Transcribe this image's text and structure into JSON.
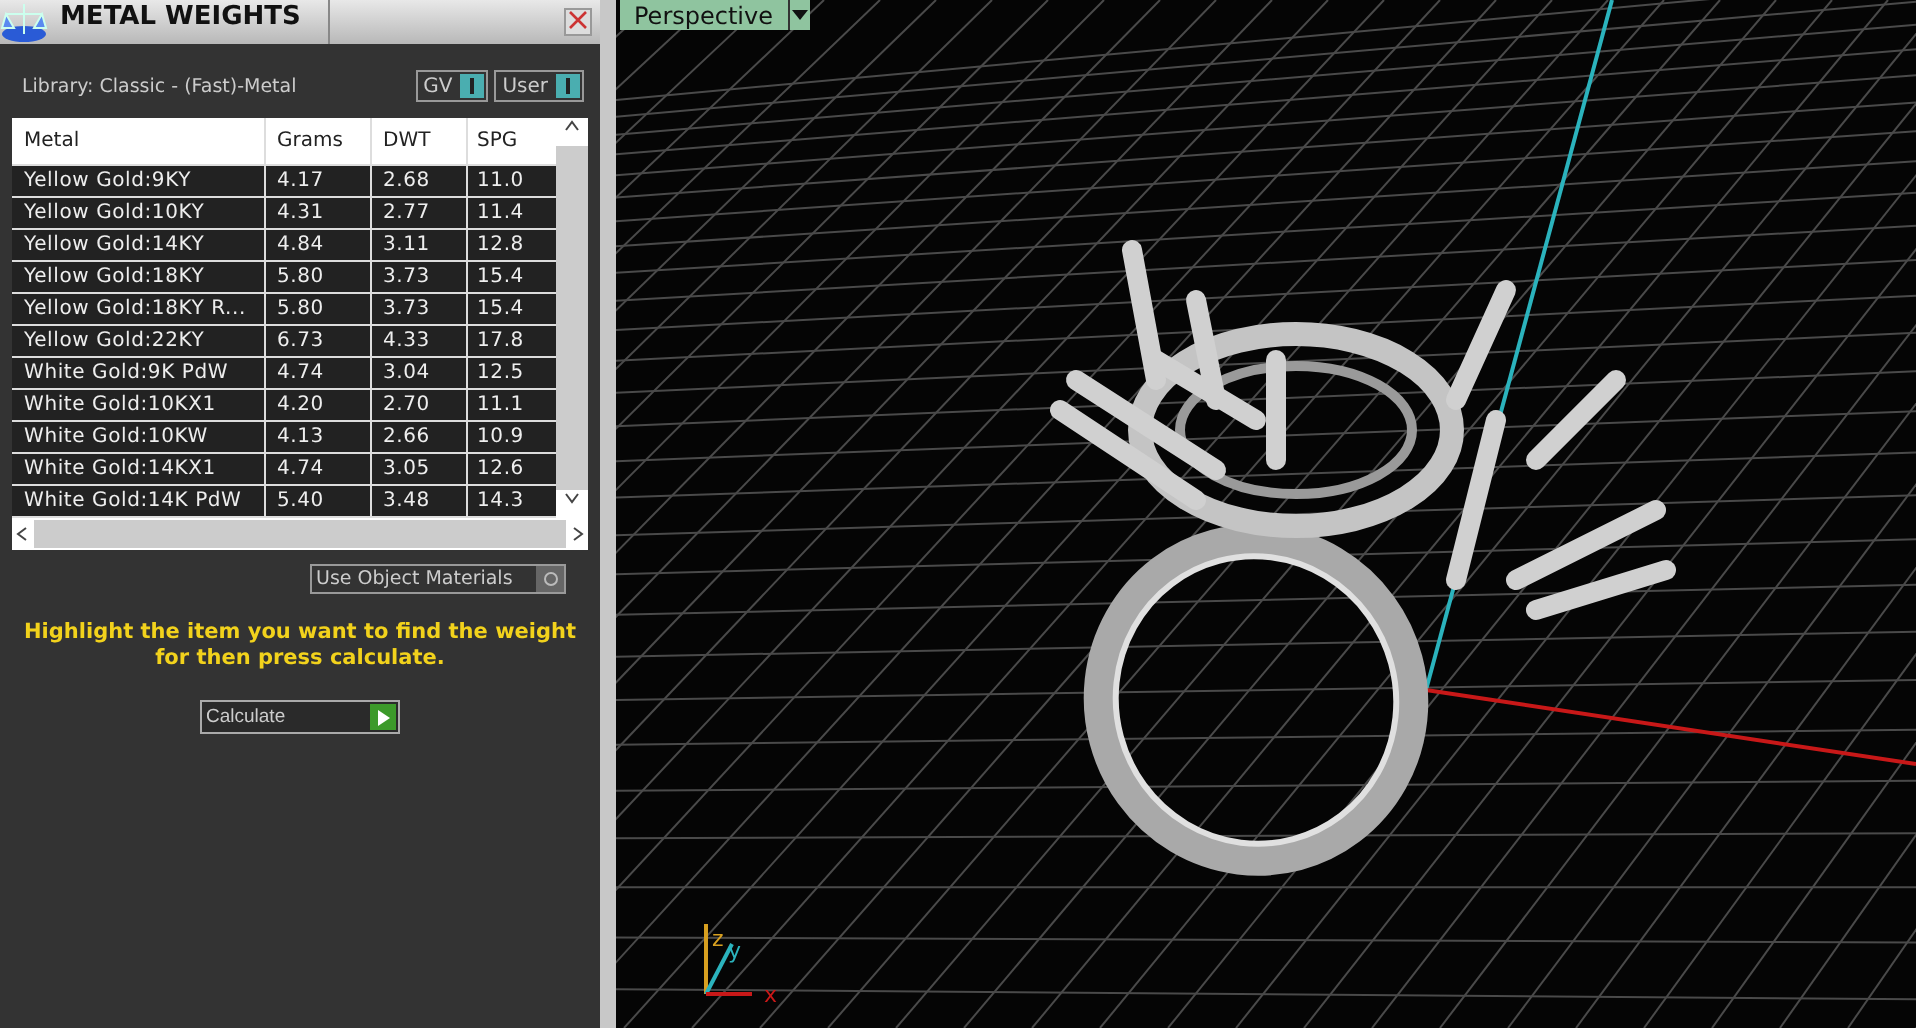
{
  "panel": {
    "title": "METAL WEIGHTS",
    "library": "Library: Classic - (Fast)-Metal",
    "toggles": [
      {
        "label": "GV",
        "on": true
      },
      {
        "label": "User",
        "on": true
      }
    ],
    "table": {
      "columns": [
        "Metal",
        "Grams",
        "DWT",
        "SPG"
      ],
      "rows": [
        [
          "Yellow Gold:9KY",
          "4.17",
          "2.68",
          "11.0"
        ],
        [
          "Yellow Gold:10KY",
          "4.31",
          "2.77",
          "11.4"
        ],
        [
          "Yellow Gold:14KY",
          "4.84",
          "3.11",
          "12.8"
        ],
        [
          "Yellow Gold:18KY",
          "5.80",
          "3.73",
          "15.4"
        ],
        [
          "Yellow Gold:18KY R...",
          "5.80",
          "3.73",
          "15.4"
        ],
        [
          "Yellow Gold:22KY",
          "6.73",
          "4.33",
          "17.8"
        ],
        [
          "White Gold:9K PdW",
          "4.74",
          "3.04",
          "12.5"
        ],
        [
          "White Gold:10KX1",
          "4.20",
          "2.70",
          "11.1"
        ],
        [
          "White Gold:10KW",
          "4.13",
          "2.66",
          "10.9"
        ],
        [
          "White Gold:14KX1",
          "4.74",
          "3.05",
          "12.6"
        ],
        [
          "White Gold:14K PdW",
          "5.40",
          "3.48",
          "14.3"
        ]
      ]
    },
    "use_object_materials": {
      "label": "Use Object Materials",
      "checked": false
    },
    "hint": "Highlight the item you want to find the weight for then press calculate.",
    "calculate": "Calculate"
  },
  "viewport": {
    "view": "Perspective",
    "axes": [
      "z",
      "y",
      "x"
    ]
  }
}
